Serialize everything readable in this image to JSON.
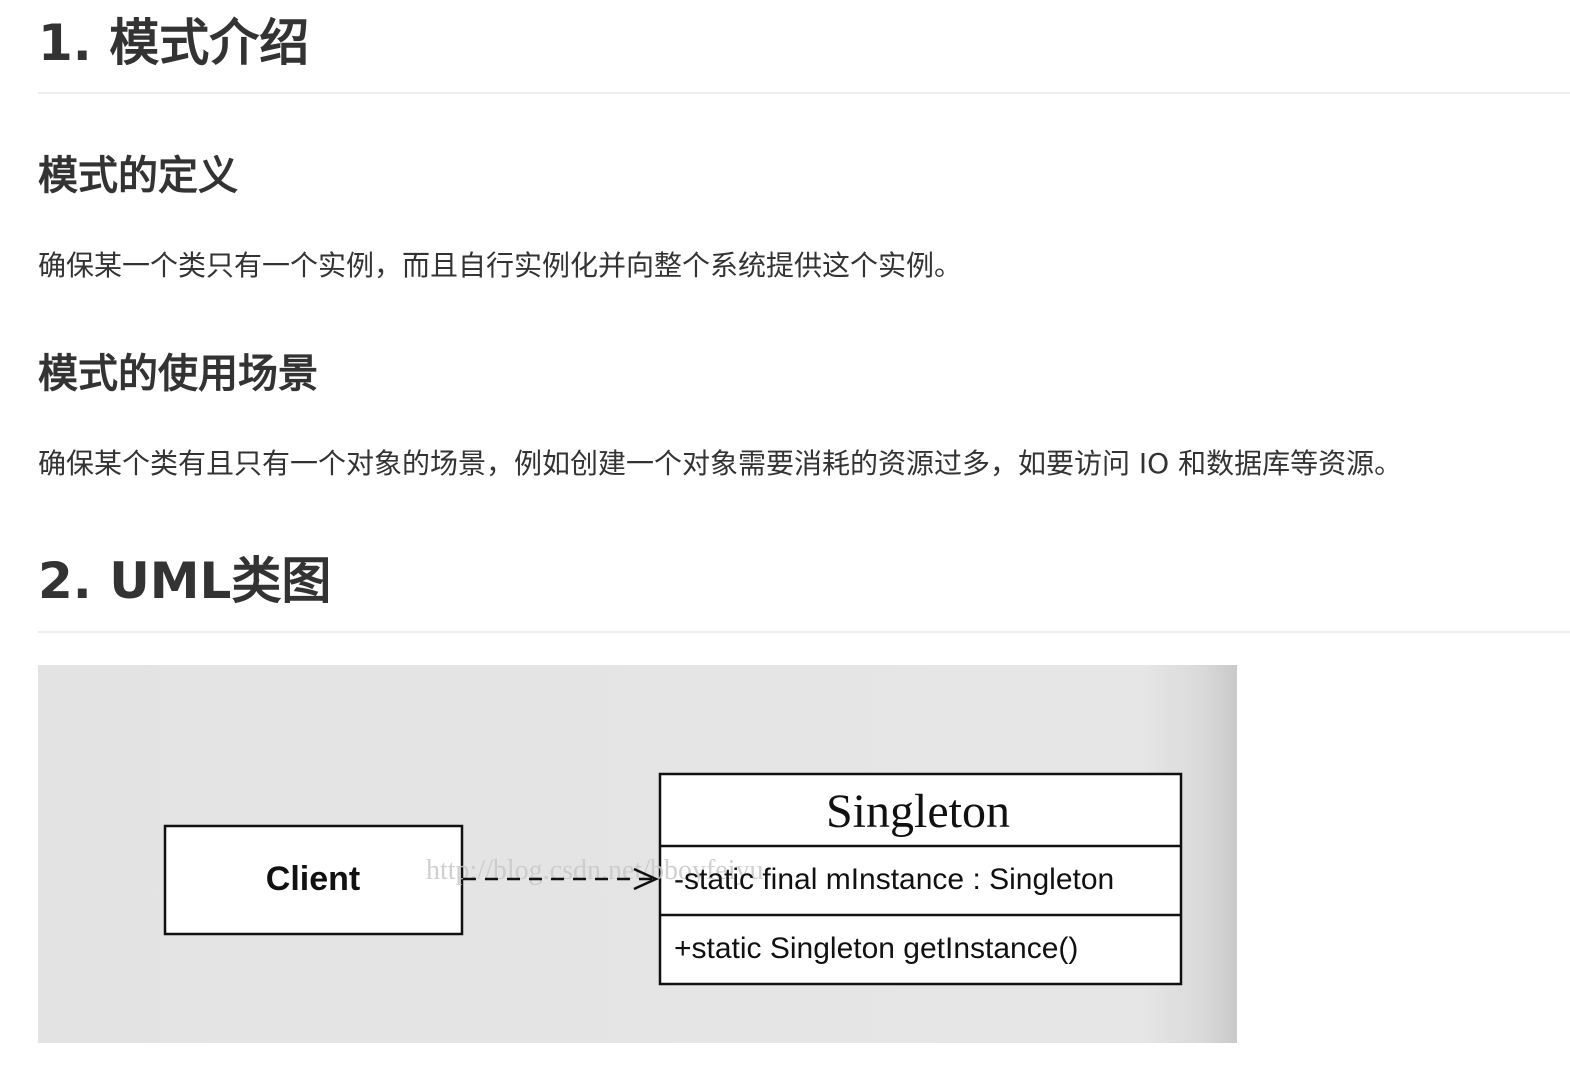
{
  "sections": [
    {
      "heading": "1. 模式介绍",
      "subsections": [
        {
          "heading": "模式的定义",
          "text": "确保某一个类只有一个实例，而且自行实例化并向整个系统提供这个实例。"
        },
        {
          "heading": "模式的使用场景",
          "text": "确保某个类有且只有一个对象的场景，例如创建一个对象需要消耗的资源过多，如要访问 IO 和数据库等资源。"
        }
      ]
    },
    {
      "heading": "2. UML类图"
    }
  ],
  "uml_diagram": {
    "client_class": "Client",
    "singleton_class": {
      "name": "Singleton",
      "field": "-static final mInstance : Singleton",
      "method": "+static Singleton getInstance()"
    },
    "watermark": "http://blog.csdn.net/bboyfeiyu"
  }
}
